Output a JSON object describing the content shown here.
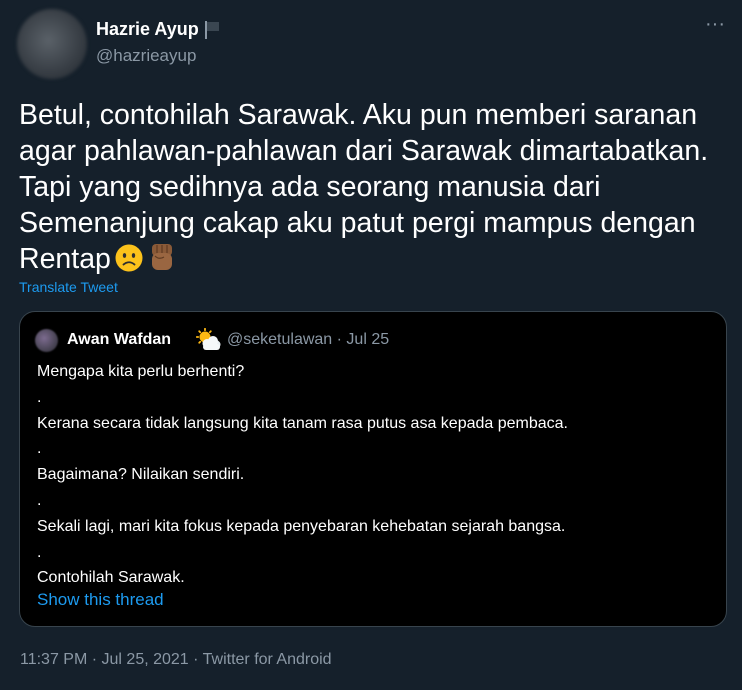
{
  "author": {
    "display_name": "Hazrie Ayup",
    "handle": "@hazrieayup",
    "avatar_icon": "blurred-avatar",
    "badge_icon": "flag-icon"
  },
  "tweet": {
    "text": "Betul, contohilah Sarawak. Aku pun memberi saranan\nagar pahlawan-pahlawan dari Sarawak dimartabatkan.\nTapi yang sedihnya ada seorang manusia dari\nSemenanjung cakap aku patut pergi mampus dengan\nRentap",
    "emojis": [
      "slightly-frowning-face-emoji",
      "raised-fist-emoji"
    ],
    "translate_label": "Translate Tweet",
    "more_icon": "more-options-icon",
    "more_label": "···"
  },
  "quote": {
    "display_name": "Awan Wafdan",
    "name_emoji": "sun-behind-cloud-emoji",
    "handle": "@seketulawan",
    "separator": "·",
    "date": "Jul 25",
    "lines": [
      "Mengapa kita perlu berhenti?",
      ".",
      "Kerana secara tidak langsung kita tanam rasa putus asa kepada pembaca.",
      ".",
      "Bagaimana? Nilaikan sendiri.",
      ".",
      "Sekali lagi, mari kita fokus kepada penyebaran kehebatan sejarah bangsa.",
      ".",
      "Contohilah Sarawak."
    ],
    "show_thread_label": "Show this thread"
  },
  "footer": {
    "text": "11:37 PM · Jul 25, 2021 · Twitter for Android"
  },
  "colors": {
    "background": "#15202b",
    "quote_background": "#000000",
    "border": "#38444d",
    "secondary_text": "#8b98a5",
    "link": "#1d9bf0"
  }
}
